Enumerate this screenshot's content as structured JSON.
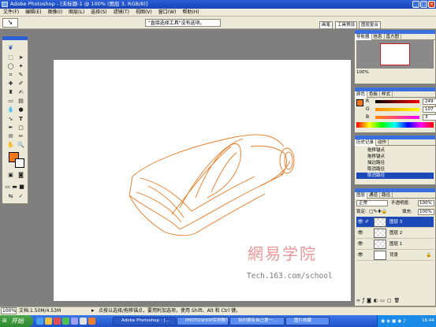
{
  "window": {
    "title": "Adobe Photoshop - [未标题-1 @ 100% (图层 3, RGB/8)]",
    "buttons": [
      "_",
      "□",
      "×"
    ]
  },
  "menu": [
    "文件(F)",
    "编辑(E)",
    "图像(I)",
    "图层(L)",
    "选择(S)",
    "滤镜(T)",
    "视图(V)",
    "窗口(W)",
    "帮助(H)"
  ],
  "options_bar": {
    "hint": "\"直接选择工具\"没有选项。"
  },
  "palette_well": {
    "tabs": [
      "画笔",
      "工具预设",
      "图层复合"
    ]
  },
  "navigator": {
    "tabs": [
      "导航器",
      "信息",
      "直方图"
    ],
    "zoom": "100%"
  },
  "color_panel": {
    "tabs": [
      "颜色",
      "色板",
      "样式"
    ],
    "fg_color": "#f07818",
    "channels": [
      {
        "label": "R",
        "value": "249"
      },
      {
        "label": "G",
        "value": "107"
      },
      {
        "label": "B",
        "value": "3"
      }
    ]
  },
  "history_panel": {
    "tabs": [
      "历史记录",
      "动作"
    ],
    "items": [
      "拖移锚点",
      "拖移锚点",
      "描边路径",
      "取消路径",
      "取消路径"
    ]
  },
  "layers_panel": {
    "tabs": [
      "图层",
      "通道",
      "路径"
    ],
    "blend_mode": "正常",
    "opacity_label": "不透明度:",
    "opacity": "100%",
    "lock_label": "锁定:",
    "fill_label": "填充:",
    "fill": "100%",
    "layers": [
      {
        "name": "图层 3",
        "active": true
      },
      {
        "name": "图层 2",
        "active": false
      },
      {
        "name": "图层 1",
        "active": false
      },
      {
        "name": "背景",
        "active": false
      }
    ]
  },
  "watermark": {
    "chinese": "網易学院",
    "url": "Tech.163.com/school"
  },
  "status_bar": {
    "zoom": "100%",
    "doc": "文档:1.50M/4.53M",
    "hint": "点按以选择/拖移锚点，要用附加选项，使用 Shift、Alt 和 Ctrl 键。"
  },
  "taskbar": {
    "start": "开始",
    "items": [
      "Adobe Photoshop - [...",
      "PHOTOSHOP实例教学...",
      "如何拥有自己第一...",
      "图片收藏"
    ],
    "clock": "16:44"
  }
}
